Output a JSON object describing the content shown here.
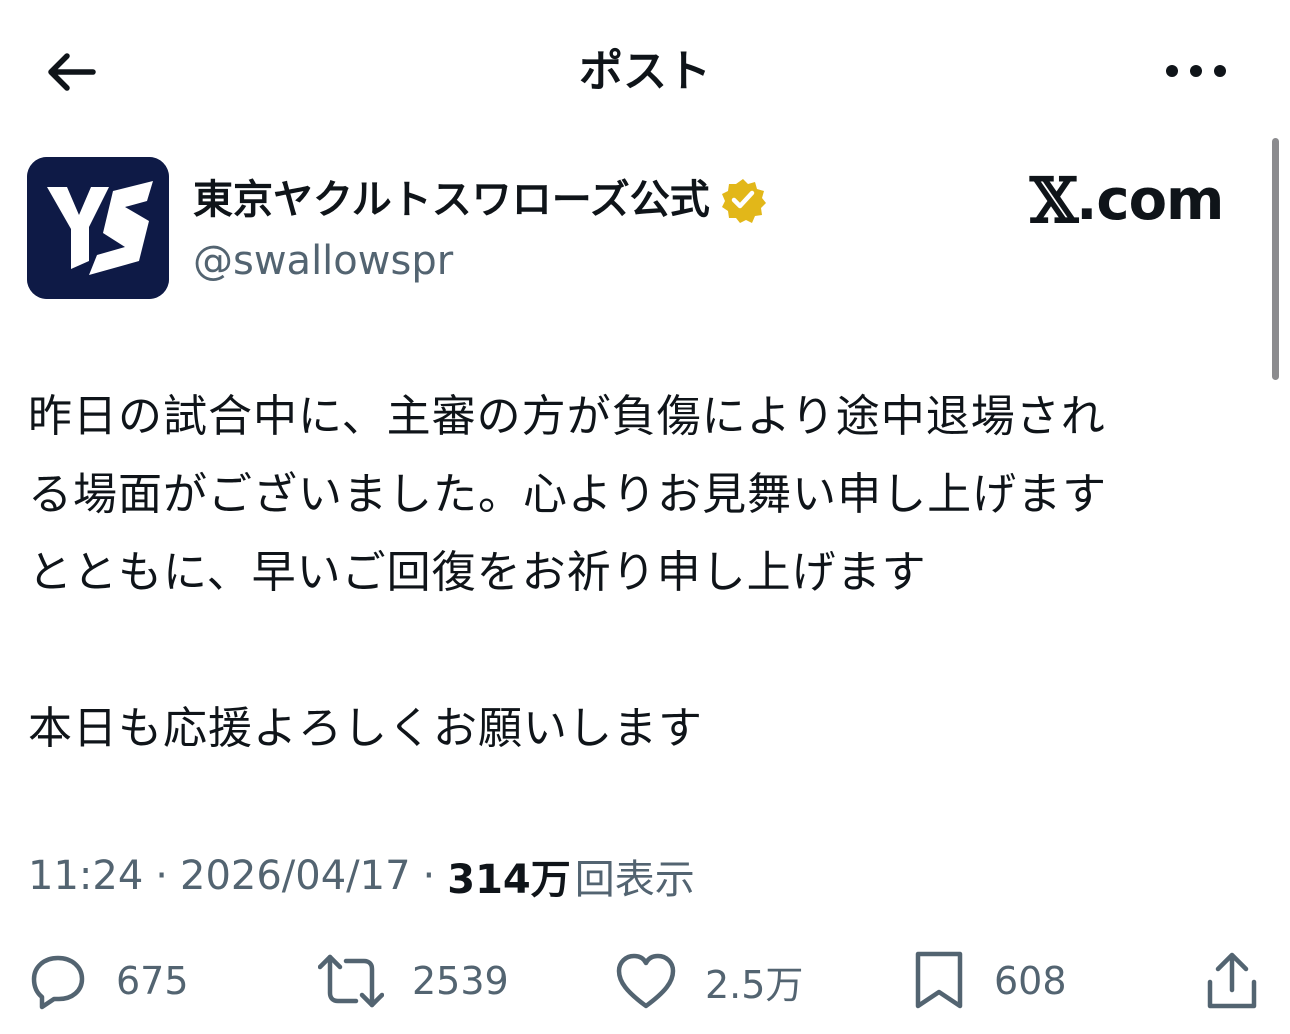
{
  "header": {
    "title": "ポスト",
    "back_icon": "arrow-left-icon",
    "more_icon": "more-horizontal-icon"
  },
  "author": {
    "name": "東京ヤクルトスワローズ公式",
    "handle": "@swallowspr",
    "verified_badge": "gold-verified-badge-icon",
    "avatar_text": "YS",
    "avatar_bg": "#0e1a46",
    "badge_color": "#e2b719"
  },
  "watermark": {
    "x_mark": "𝕏",
    "suffix": ".com"
  },
  "post": {
    "lines": [
      "昨日の試合中に、主審の方が負傷により途中退場され",
      "る場面がございました。心よりお見舞い申し上げます",
      "とともに、早いご回復をお祈り申し上げます",
      "",
      "本日も応援よろしくお願いします"
    ]
  },
  "meta": {
    "time": "11:24",
    "separator": "·",
    "date": "2026/04/17",
    "views_count": "314万",
    "views_label": "回表示"
  },
  "actions": {
    "reply": {
      "icon": "reply-icon",
      "count": "675"
    },
    "repost": {
      "icon": "repost-icon",
      "count": "2539"
    },
    "like": {
      "icon": "heart-icon",
      "count": "2.5万"
    },
    "bookmark": {
      "icon": "bookmark-icon",
      "count": "608"
    },
    "share": {
      "icon": "share-icon"
    }
  }
}
